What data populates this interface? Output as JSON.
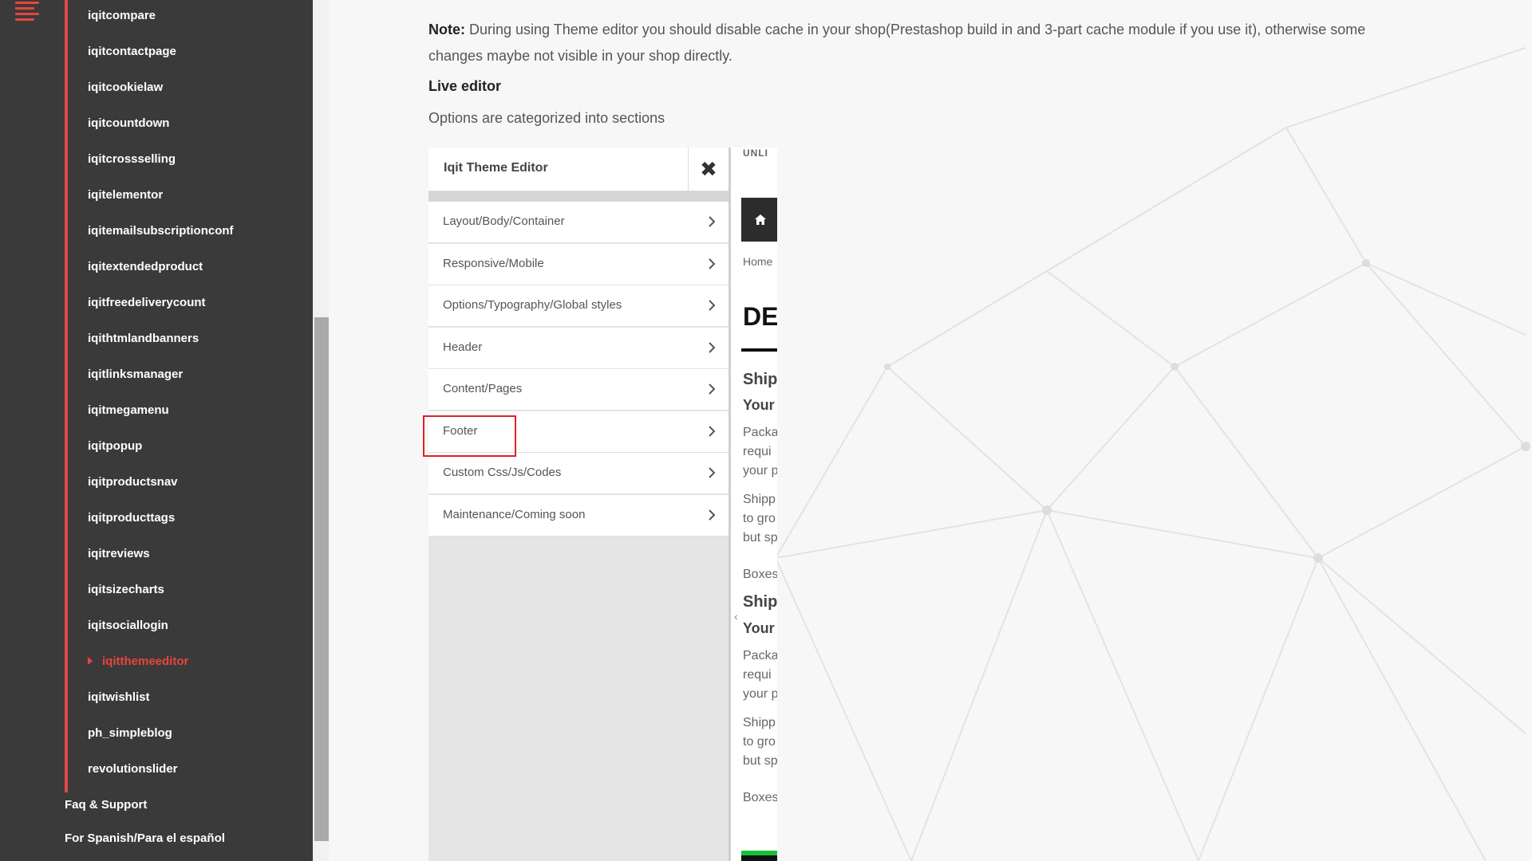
{
  "sidebar": {
    "modules": [
      "iqitcompare",
      "iqitcontactpage",
      "iqitcookielaw",
      "iqitcountdown",
      "iqitcrossselling",
      "iqitelementor",
      "iqitemailsubscriptionconf",
      "iqitextendedproduct",
      "iqitfreedeliverycount",
      "iqithtmlandbanners",
      "iqitlinksmanager",
      "iqitmegamenu",
      "iqitpopup",
      "iqitproductsnav",
      "iqitproducttags",
      "iqitreviews",
      "iqitsizecharts",
      "iqitsociallogin",
      "iqitthemeeditor",
      "iqitwishlist",
      "ph_simpleblog",
      "revolutionslider"
    ],
    "active_module": "iqitthemeeditor",
    "links": [
      "Faq & Support",
      "For Spanish/Para el español"
    ]
  },
  "content": {
    "note_label": "Note:",
    "note_line1": " During using Theme editor you should disable cache in your shop(Prestashop build in and 3-part cache module if you use it), otherwise some",
    "note_line2": "changes maybe not visible in your shop directly.",
    "live_editor_heading": "Live editor",
    "options_text": "Options are categorized into sections"
  },
  "editor": {
    "title": "Iqit Theme Editor",
    "close_glyph": "✖",
    "items": [
      "Layout/Body/Container",
      "Responsive/Mobile",
      "Options/Typography/Global styles",
      "Header",
      "Content/Pages",
      "Footer",
      "Custom Css/Js/Codes",
      "Maintenance/Coming soon"
    ],
    "highlighted_item": "Footer"
  },
  "preview": {
    "top_text": "UNLI",
    "breadcrumb": "Home",
    "heading": "DE",
    "block1_title": "Ship",
    "block1_sub": "Your",
    "block1_lines": [
      "Packa",
      "requi",
      "your p"
    ],
    "block1_lines2": [
      "Shipp",
      "to gro",
      "but sp"
    ],
    "block1_boxes": "Boxes",
    "block2_title": "Ship",
    "block2_sub": "Your",
    "block2_lines": [
      "Packa",
      "requi",
      "your p"
    ],
    "block2_lines2": [
      "Shipp",
      "to gro",
      "but sp"
    ],
    "block2_boxes": "Boxes",
    "collapse_glyph": "‹"
  },
  "colors": {
    "sidebar_bg": "#3a3a3a",
    "accent": "#e8453c",
    "highlight_box": "#e0202a",
    "page_bg": "#f7f7f7"
  }
}
